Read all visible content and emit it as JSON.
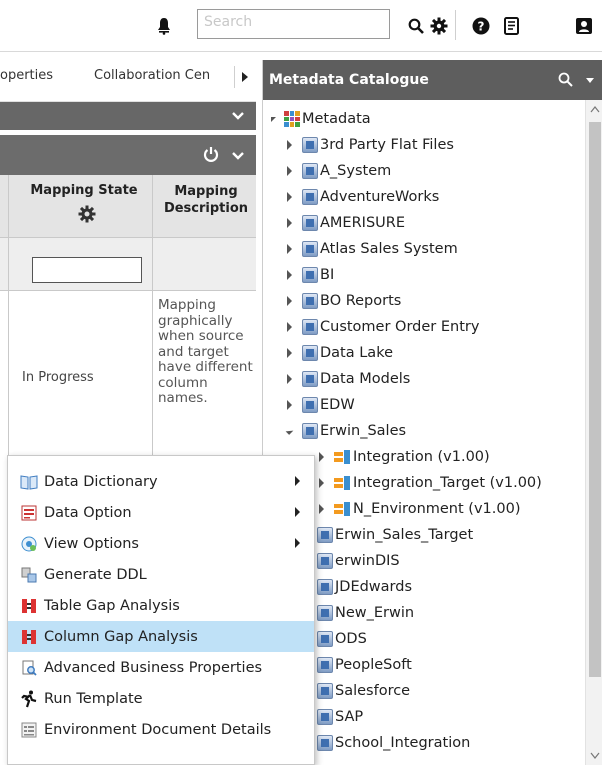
{
  "topbar": {
    "search_placeholder": "Search",
    "icons": [
      "bell-icon",
      "search-icon",
      "gear-icon",
      "help-icon",
      "notes-icon",
      "user-icon"
    ]
  },
  "left": {
    "tabs": [
      "operties",
      "Collaboration Cen"
    ],
    "grid": {
      "col1_header": "Mapping State",
      "col2_header": "Mapping Description",
      "row_state": "In Progress",
      "row_description": "Mapping graphically when source and target have different column names."
    }
  },
  "context_menu": {
    "items": [
      {
        "label": "Data Dictionary",
        "submenu": true,
        "icon": "book-icon"
      },
      {
        "label": "Data Option",
        "submenu": true,
        "icon": "data-option-icon"
      },
      {
        "label": "View Options",
        "submenu": true,
        "icon": "view-options-icon"
      },
      {
        "label": "Generate DDL",
        "submenu": false,
        "icon": "ddl-icon"
      },
      {
        "label": "Table Gap Analysis",
        "submenu": false,
        "icon": "gap-analysis-icon"
      },
      {
        "label": "Column Gap Analysis",
        "submenu": false,
        "icon": "gap-analysis-icon",
        "selected": true
      },
      {
        "label": "Advanced Business Properties",
        "submenu": false,
        "icon": "document-search-icon"
      },
      {
        "label": "Run Template",
        "submenu": false,
        "icon": "runner-icon"
      },
      {
        "label": "Environment Document Details",
        "submenu": false,
        "icon": "document-icon"
      }
    ]
  },
  "catalogue": {
    "title": "Metadata Catalogue",
    "root": "Metadata",
    "nodes": [
      "3rd Party Flat Files",
      "A_System",
      "AdventureWorks",
      "AMERISURE",
      "Atlas Sales System",
      "BI",
      "BO Reports",
      "Customer Order Entry",
      "Data Lake",
      "Data Models",
      "EDW",
      "Erwin_Sales"
    ],
    "erwin_children": [
      "Integration (v1.00)",
      "Integration_Target (v1.00)",
      "N_Environment (v1.00)"
    ],
    "more_nodes": [
      "Erwin_Sales_Target",
      "erwinDIS",
      "JDEdwards",
      "New_Erwin",
      "ODS",
      "PeopleSoft",
      "Salesforce",
      "SAP",
      "School_Integration"
    ]
  },
  "colors": {
    "header_dark": "#5e5e5e",
    "selection": "#bfe1f7"
  }
}
